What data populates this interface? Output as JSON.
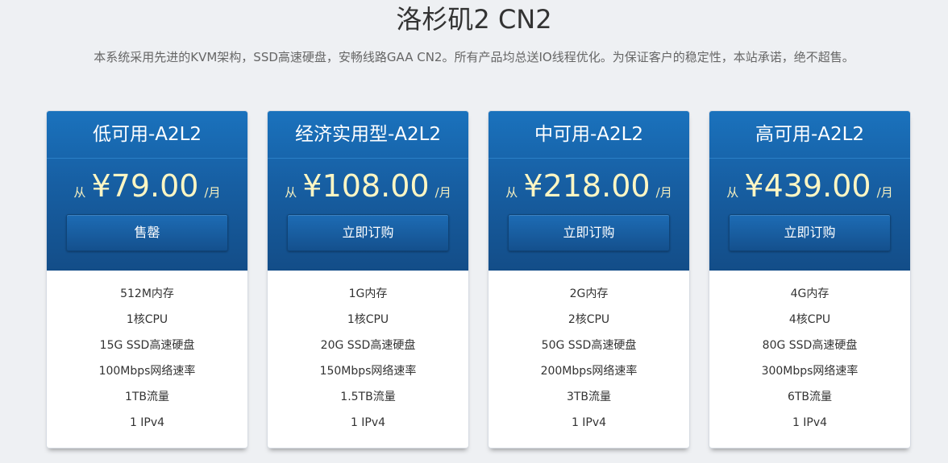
{
  "header": {
    "title": "洛杉矶2 CN2",
    "subtitle": "本系统采用先进的KVM架构，SSD高速硬盘，安畅线路GAA CN2。所有产品均总送IO线程优化。为保证客户的稳定性，本站承诺，绝不超售。"
  },
  "price_prefix": "从",
  "price_unit": "/月",
  "colors": {
    "header_blue": "#1a72bd",
    "header_blue_dark": "#134d88",
    "price_text": "#fdf6c3",
    "background": "#eef0f3"
  },
  "plans": [
    {
      "name": "低可用-A2L2",
      "price": "¥79.00",
      "button": "售罄",
      "features": [
        "512M内存",
        "1核CPU",
        "15G SSD高速硬盘",
        "100Mbps网络速率",
        "1TB流量",
        "1 IPv4"
      ]
    },
    {
      "name": "经济实用型-A2L2",
      "price": "¥108.00",
      "button": "立即订购",
      "features": [
        "1G内存",
        "1核CPU",
        "20G SSD高速硬盘",
        "150Mbps网络速率",
        "1.5TB流量",
        "1 IPv4"
      ]
    },
    {
      "name": "中可用-A2L2",
      "price": "¥218.00",
      "button": "立即订购",
      "features": [
        "2G内存",
        "2核CPU",
        "50G SSD高速硬盘",
        "200Mbps网络速率",
        "3TB流量",
        "1 IPv4"
      ]
    },
    {
      "name": "高可用-A2L2",
      "price": "¥439.00",
      "button": "立即订购",
      "features": [
        "4G内存",
        "4核CPU",
        "80G SSD高速硬盘",
        "300Mbps网络速率",
        "6TB流量",
        "1 IPv4"
      ]
    }
  ]
}
